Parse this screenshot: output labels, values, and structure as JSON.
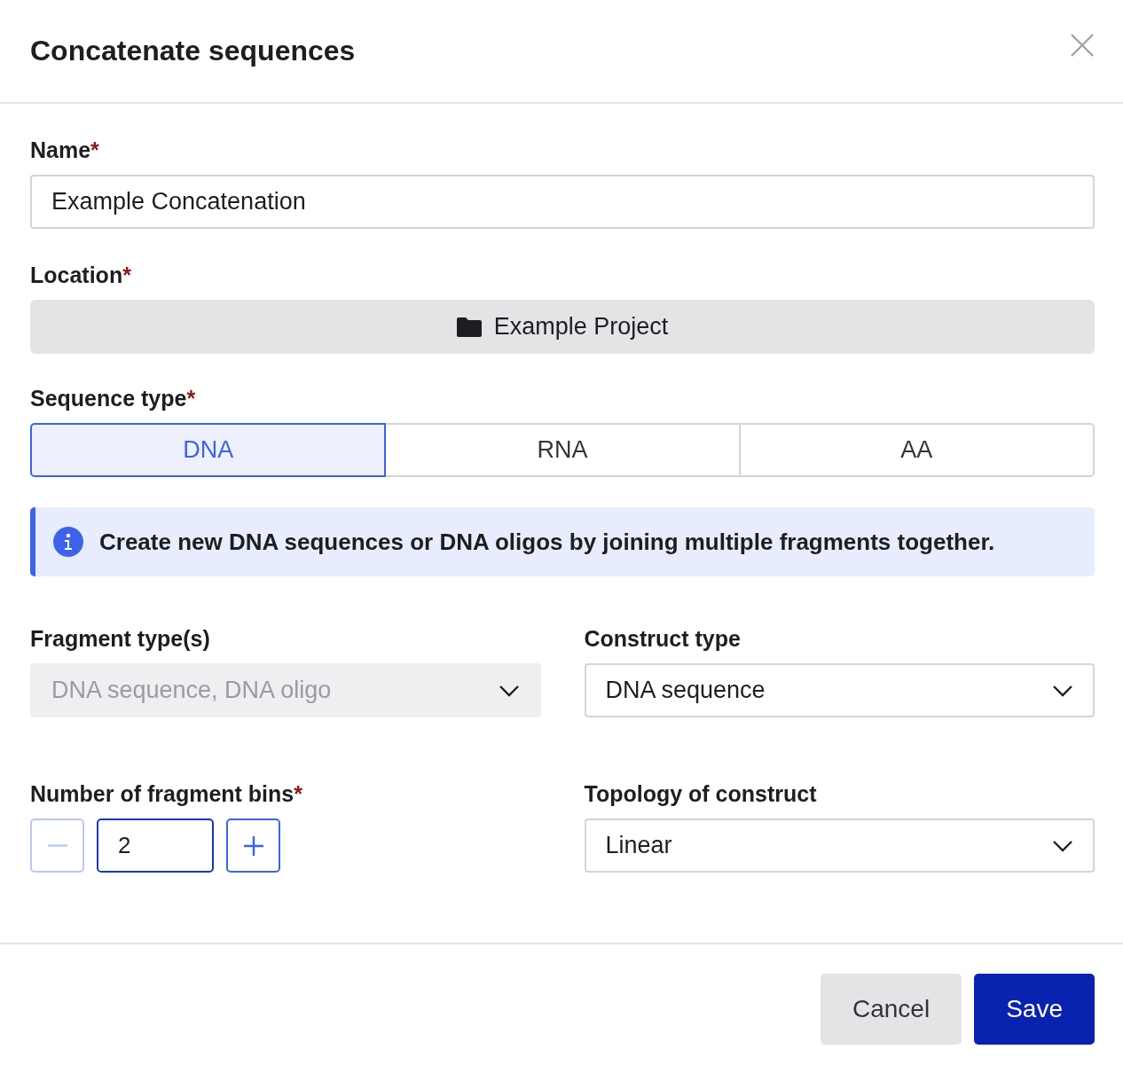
{
  "dialog": {
    "title": "Concatenate sequences"
  },
  "name_field": {
    "label": "Name",
    "required_mark": "*",
    "value": "Example Concatenation"
  },
  "location": {
    "label": "Location",
    "required_mark": "*",
    "value": "Example Project"
  },
  "sequence_type": {
    "label": "Sequence type",
    "required_mark": "*",
    "options": [
      {
        "label": "DNA",
        "selected": true
      },
      {
        "label": "RNA",
        "selected": false
      },
      {
        "label": "AA",
        "selected": false
      }
    ]
  },
  "info": {
    "text": "Create new DNA sequences or DNA oligos by joining multiple fragments together."
  },
  "fragment_types": {
    "label": "Fragment type(s)",
    "value": "DNA sequence, DNA oligo",
    "disabled": true
  },
  "construct_type": {
    "label": "Construct type",
    "value": "DNA sequence",
    "disabled": false
  },
  "bins": {
    "label": "Number of fragment bins",
    "required_mark": "*",
    "value": "2",
    "decrement_disabled": true,
    "increment_disabled": false
  },
  "topology": {
    "label": "Topology of construct",
    "value": "Linear",
    "disabled": false
  },
  "buttons": [
    {
      "label": "Cancel",
      "kind": "secondary"
    },
    {
      "label": "Save",
      "kind": "primary"
    }
  ]
}
